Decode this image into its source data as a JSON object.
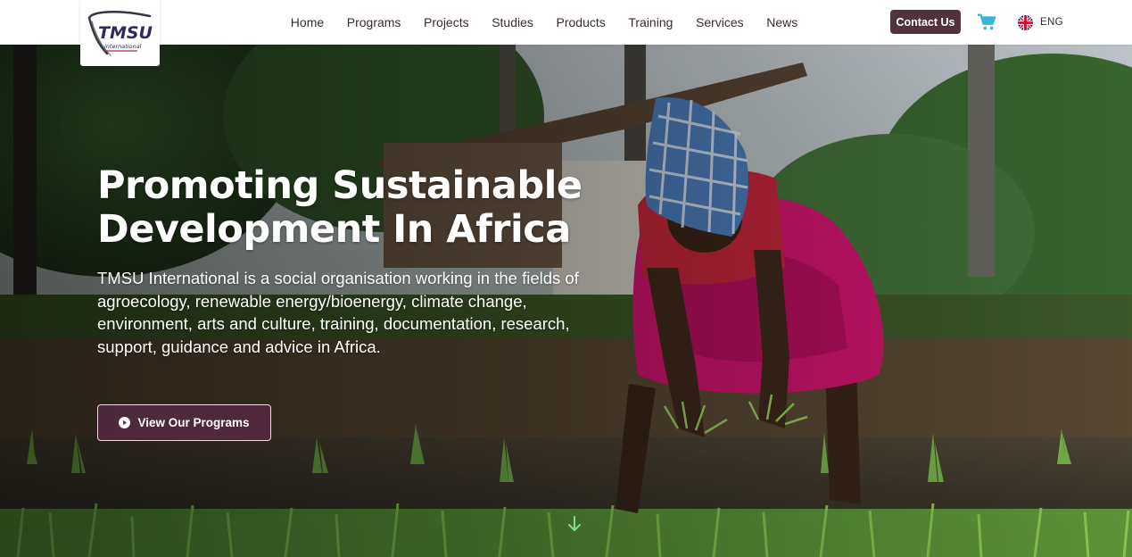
{
  "brand": {
    "logo_text": "TMSU",
    "logo_subtext": "international"
  },
  "nav": {
    "items": [
      {
        "label": "Home"
      },
      {
        "label": "Programs"
      },
      {
        "label": "Projects"
      },
      {
        "label": "Studies"
      },
      {
        "label": "Products"
      },
      {
        "label": "Training"
      },
      {
        "label": "Services"
      },
      {
        "label": "News"
      }
    ],
    "contact_label": "Contact Us",
    "cart_icon": "cart-icon",
    "language": {
      "flag_icon": "uk-flag-icon",
      "label": "ENG"
    }
  },
  "hero": {
    "title": "Promoting Sustainable Development In Africa",
    "description": "TMSU International is a social organisation working in the fields of agroecology, renewable energy/bioenergy, climate change, environment, arts and culture, training, documentation, research, support, guidance and advice in Africa.",
    "cta_label": "View Our Programs",
    "cta_icon": "play-circle-icon",
    "scroll_icon": "arrow-down-icon"
  },
  "colors": {
    "brand_primary": "#51323f",
    "cart_accent": "#35b6d8",
    "scroll_arrow": "#7fe08a"
  }
}
